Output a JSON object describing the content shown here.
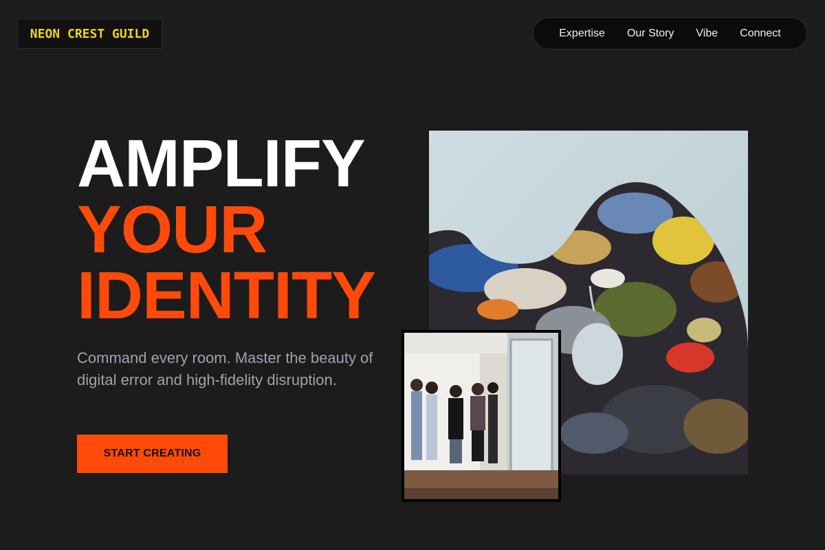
{
  "brand": {
    "name": "NEON CREST GUILD",
    "color": "#f2d21b"
  },
  "nav": {
    "items": [
      "Expertise",
      "Our Story",
      "Vibe",
      "Connect"
    ]
  },
  "hero": {
    "headline": [
      "AMPLIFY",
      "YOUR",
      "IDENTITY"
    ],
    "subcopy": "Command every room. Master the beauty of digital error and high-fidelity disruption.",
    "cta_label": "START CREATING",
    "accent": "#ff4a0a"
  },
  "images": {
    "main": {
      "subject": "paint palette with thick multicolor paint on light wall"
    },
    "inset": {
      "subject": "people standing in a gallery space near a glass door"
    }
  }
}
